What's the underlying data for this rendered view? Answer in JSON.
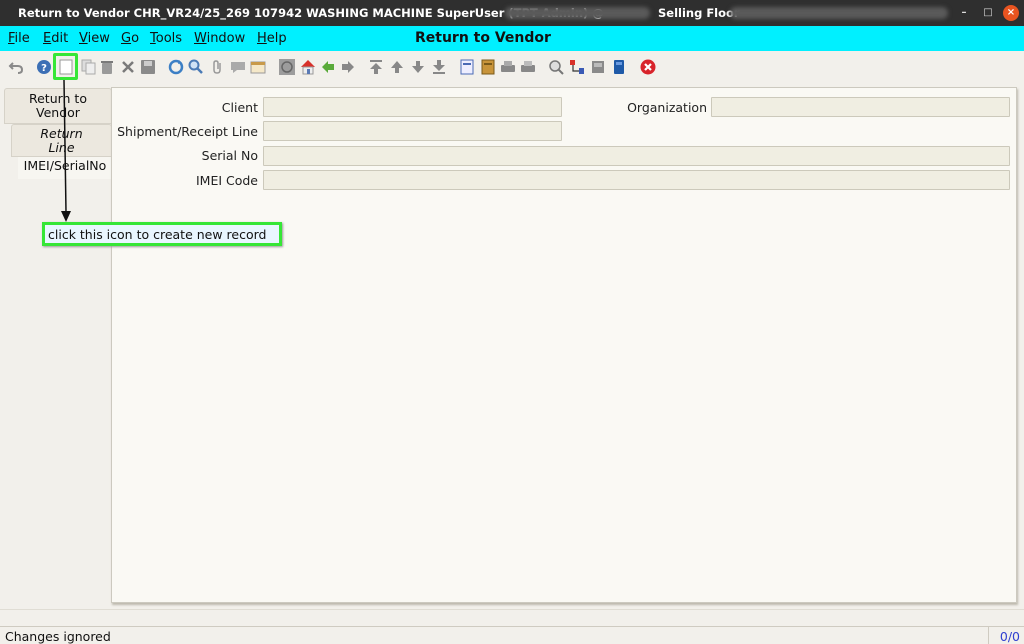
{
  "titlebar": {
    "title": "Return to Vendor  CHR_VR24/25_269  107942  WASHING MACHINE  SuperUser (TPT Admin) @",
    "location": "Selling Floor",
    "minimize_icon": "minimize-icon",
    "maximize_icon": "maximize-icon",
    "close_icon": "close-icon"
  },
  "menubar": {
    "items": [
      {
        "label": "File"
      },
      {
        "label": "Edit"
      },
      {
        "label": "View"
      },
      {
        "label": "Go"
      },
      {
        "label": "Tools"
      },
      {
        "label": "Window"
      },
      {
        "label": "Help"
      }
    ],
    "window_title": "Return to Vendor"
  },
  "toolbar": {
    "icons": [
      "undo-icon",
      "help-icon",
      "new-record-icon",
      "copy-record-icon",
      "delete-icon",
      "delete-selection-icon",
      "save-icon",
      "refresh-icon",
      "find-icon",
      "attachment-icon",
      "chat-icon",
      "history-icon",
      "home-icon",
      "parent-icon",
      "back-icon",
      "forward-icon",
      "first-record-icon",
      "previous-record-icon",
      "next-record-icon",
      "last-record-icon",
      "report-icon",
      "archive-icon",
      "print-icon",
      "print-preview-icon",
      "zoom-across-icon",
      "workflow-icon",
      "process-icon",
      "product-info-icon",
      "end-icon"
    ],
    "highlight_color": "#36e636"
  },
  "tabs": [
    {
      "label": "Return to Vendor"
    },
    {
      "label": "Return Line"
    },
    {
      "label": "IMEI/SerialNo"
    }
  ],
  "form": {
    "client_label": "Client",
    "client_value": "",
    "organization_label": "Organization",
    "organization_value": "",
    "shipment_label": "Shipment/Receipt Line",
    "shipment_value": "",
    "serial_label": "Serial No",
    "serial_value": "",
    "imei_label": "IMEI Code",
    "imei_value": ""
  },
  "annotation": {
    "text": "click this icon to create new record",
    "border_color": "#36e636"
  },
  "status": {
    "message": "Changes ignored",
    "counter": "0/0"
  },
  "colors": {
    "menubar_bg": "#00f0ff",
    "titlebar_bg": "#2f2f2f",
    "close_button": "#e95420"
  }
}
